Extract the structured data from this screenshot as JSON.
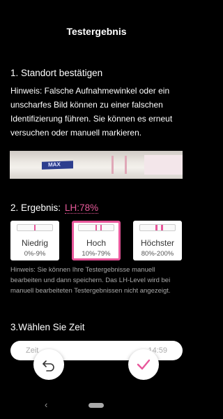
{
  "header": {
    "title": "Testergebnis"
  },
  "step1": {
    "heading": "1. Standort bestätigen",
    "hint": "Hinweis: Falsche Aufnahmewinkel oder ein unscharfes Bild können zu einer falschen Identifizierung führen. Sie können es erneut versuchen oder manuell markieren."
  },
  "strip": {
    "brand": "MAX"
  },
  "step2": {
    "label": "2. Ergebnis:",
    "value": "LH:78%",
    "options": [
      {
        "label": "Niedrig",
        "range": "0%-9%",
        "selected": false
      },
      {
        "label": "Hoch",
        "range": "10%-79%",
        "selected": true
      },
      {
        "label": "Höchster",
        "range": "80%-200%",
        "selected": false
      }
    ],
    "note": "Hinweis: Sie können Ihre Testergebnisse manuell bearbeiten und dann speichern. Das LH-Level wird bei manuell bearbeiteten Testergebnissen nicht angezeigt."
  },
  "step3": {
    "heading": "3.Wählen Sie Zeit",
    "time_label": "Zeit",
    "time_value": "14:59"
  },
  "colors": {
    "accent": "#e8579b",
    "background": "#000000"
  },
  "icons": {
    "undo": "undo-icon",
    "confirm": "check-icon",
    "nav_back": "nav-back-icon"
  }
}
